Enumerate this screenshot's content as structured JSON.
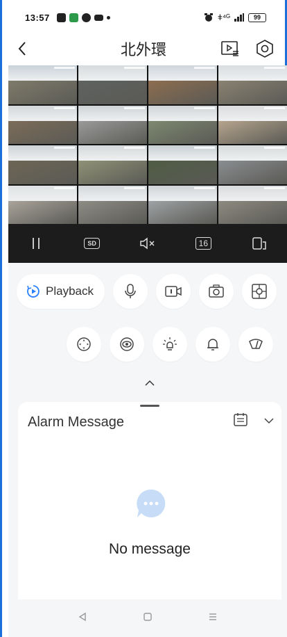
{
  "status": {
    "time": "13:57",
    "battery": "99",
    "signal": "ǂ⁴ᴳ"
  },
  "header": {
    "title": "北外環",
    "back_icon": "chevron-left-icon",
    "playback_list_icon": "playback-list-icon",
    "settings_icon": "hexagon-gear-icon"
  },
  "grid": {
    "selected_index": 0,
    "cells": [
      {
        "sky": "#c9d2d9",
        "ground": "#7f7b6a"
      },
      {
        "sky": "#d6dadd",
        "ground": "#5f6260"
      },
      {
        "sky": "#cfd5db",
        "ground": "#8d6d4f"
      },
      {
        "sky": "#d9dde0",
        "ground": "#8a8272"
      },
      {
        "sky": "#d3d7da",
        "ground": "#7c6c58"
      },
      {
        "sky": "#cfd3d6",
        "ground": "#9a9a9a"
      },
      {
        "sky": "#d0d4d6",
        "ground": "#7d8870"
      },
      {
        "sky": "#dadcdd",
        "ground": "#b5a48d"
      },
      {
        "sky": "#cdd2d6",
        "ground": "#6d6655"
      },
      {
        "sky": "#d5d8da",
        "ground": "#8f9276"
      },
      {
        "sky": "#c8cfd3",
        "ground": "#4f5c44"
      },
      {
        "sky": "#d7dadc",
        "ground": "#8a8d90"
      },
      {
        "sky": "#dfe2e4",
        "ground": "#a9a49b"
      },
      {
        "sky": "#d4d8db",
        "ground": "#8e8c85"
      },
      {
        "sky": "#cfd4d8",
        "ground": "#9ea2a4"
      },
      {
        "sky": "#d8dbdd",
        "ground": "#8d8a80"
      }
    ]
  },
  "controls": {
    "pause_icon": "pause-icon",
    "quality_label": "SD",
    "mute_icon": "speaker-muted-icon",
    "split_label": "16",
    "fullscreen_icon": "rotate-screen-icon"
  },
  "actions": {
    "playback_label": "Playback",
    "row1_icons": [
      "microphone-icon",
      "record-video-icon",
      "camera-snapshot-icon",
      "multi-view-icon"
    ],
    "row2_icons": [
      "ptz-icon",
      "eye-icon",
      "light-icon",
      "alarm-bell-icon",
      "wiper-icon"
    ]
  },
  "alarm": {
    "title": "Alarm Message",
    "empty_text": "No message"
  },
  "colors": {
    "accent": "#2a7fff",
    "empty_bubble": "#c6dcf7"
  }
}
